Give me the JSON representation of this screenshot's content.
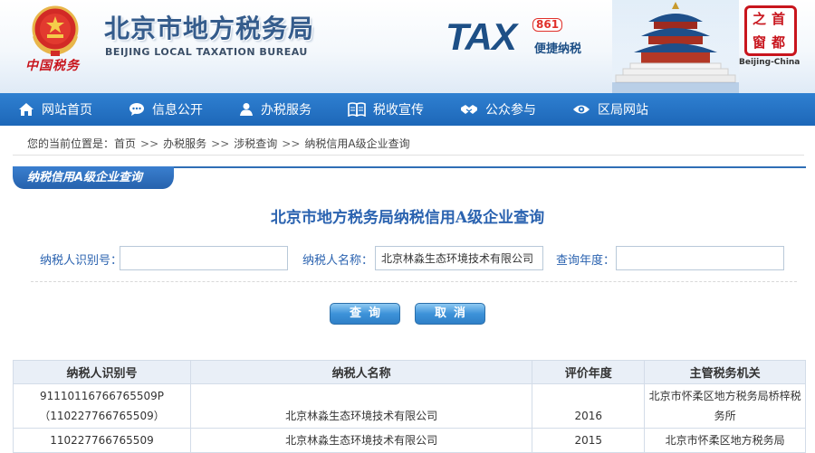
{
  "header": {
    "site_title": "北京市地方税务局",
    "site_subtitle": "BEIJING LOCAL TAXATION BUREAU",
    "china_tax_text": "中国税务",
    "tax_logo": {
      "word": "TAX",
      "badge": "861",
      "tagline": "便捷纳税"
    },
    "capital_seal": {
      "chars": [
        "首",
        "都",
        "之",
        "窗"
      ],
      "caption": "Beijing-China"
    }
  },
  "nav": {
    "items": [
      {
        "label": "网站首页",
        "icon": "home-icon"
      },
      {
        "label": "信息公开",
        "icon": "chat-bubble-icon"
      },
      {
        "label": "办税服务",
        "icon": "person-icon"
      },
      {
        "label": "税收宣传",
        "icon": "book-icon"
      },
      {
        "label": "公众参与",
        "icon": "handshake-icon"
      },
      {
        "label": "区局网站",
        "icon": "eye-icon"
      }
    ]
  },
  "breadcrumb": {
    "prefix": "您的当前位置是：",
    "items": [
      "首页",
      "办税服务",
      "涉税查询",
      "纳税信用A级企业查询"
    ],
    "separator": ">>"
  },
  "section_tab": "纳税信用A级企业查询",
  "page_title": "北京市地方税务局纳税信用A级企业查询",
  "form": {
    "taxpayer_id": {
      "label": "纳税人识别号：",
      "value": ""
    },
    "taxpayer_name": {
      "label": "纳税人名称：",
      "value": "北京林淼生态环境技术有限公司"
    },
    "query_year": {
      "label": "查询年度：",
      "value": ""
    }
  },
  "buttons": {
    "query": "查询",
    "cancel": "取消"
  },
  "colors": {
    "nav_bg": "#2473c4",
    "accent": "#2b63b0",
    "emblem_red": "#c8151d"
  },
  "table": {
    "headers": [
      "纳税人识别号",
      "纳税人名称",
      "评价年度",
      "主管税务机关"
    ],
    "rows": [
      {
        "id_line1": "91110116766765509P",
        "id_line2": "（110227766765509）",
        "name": "北京林淼生态环境技术有限公司",
        "year": "2016",
        "authority": "北京市怀柔区地方税务局桥梓税务所"
      },
      {
        "id_line1": "110227766765509",
        "id_line2": "",
        "name": "北京林淼生态环境技术有限公司",
        "year": "2015",
        "authority": "北京市怀柔区地方税务局"
      }
    ]
  }
}
